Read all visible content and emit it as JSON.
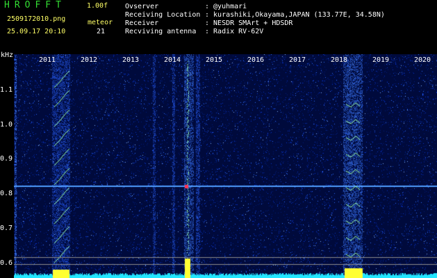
{
  "header": {
    "title": "HROFFT",
    "version": "1.00f",
    "filename": "2509172010.png",
    "meteor_label": "meteor",
    "datetime": "25.09.17 20:10",
    "meteor_count": "21"
  },
  "info": [
    {
      "label": "Ovserver",
      "value": ": @yuhmari"
    },
    {
      "label": "Receiving Location",
      "value": ": kurashiki,Okayama,JAPAN (133.77E, 34.58N)"
    },
    {
      "label": "Receiver",
      "value": ": NESDR SMArt + HDSDR"
    },
    {
      "label": "Recviving antenna",
      "value": ": Radix RV-62V"
    }
  ],
  "plot": {
    "y_unit": "kHz",
    "y_ticks": [
      "1.1",
      "1.0",
      "0.9",
      "0.8",
      "0.7",
      "0.6"
    ],
    "x_ticks": [
      "2011",
      "2012",
      "2013",
      "2014",
      "2015",
      "2016",
      "2017",
      "2018",
      "2019",
      "2020"
    ]
  },
  "colors": {
    "background": "#000000",
    "spectrogram_low": "#000a55",
    "spectrogram_mid": "#1a55ff",
    "header_title": "#33dd33",
    "carrier_line": "#4f9cff",
    "echo": "#9effa0",
    "detection_bar": "#ffff33",
    "noise_floor": "#22e5ff"
  }
}
